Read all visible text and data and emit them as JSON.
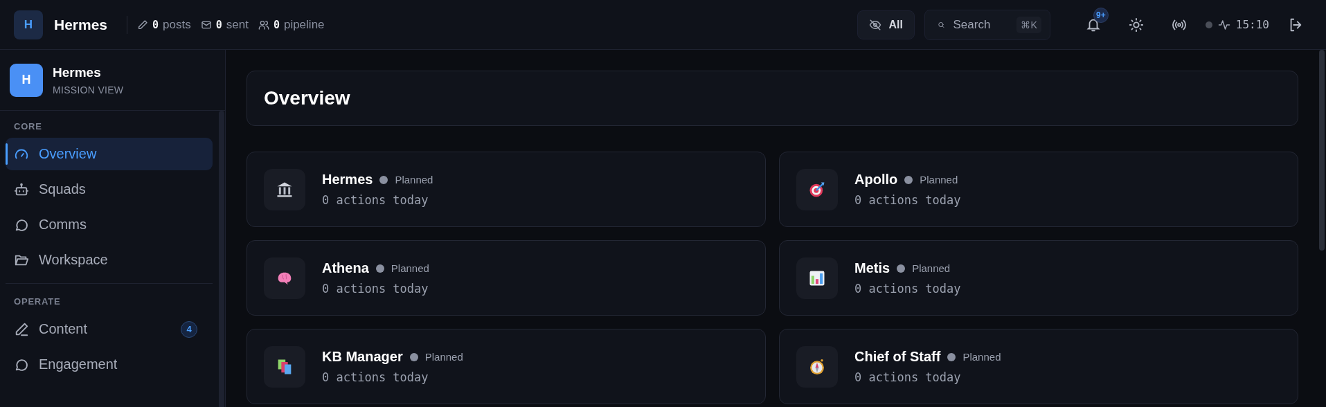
{
  "topbar": {
    "logo": "H",
    "title": "Hermes",
    "stats": [
      {
        "value": "0",
        "label": "posts"
      },
      {
        "value": "0",
        "label": "sent"
      },
      {
        "value": "0",
        "label": "pipeline"
      }
    ],
    "filter": {
      "label": "All"
    },
    "search": {
      "placeholder": "Search",
      "shortcut": "⌘K"
    },
    "notifications": {
      "badge": "9+"
    },
    "clock": "15:10"
  },
  "sidebar": {
    "logo": "H",
    "title": "Hermes",
    "subtitle": "MISSION VIEW",
    "sections": [
      {
        "label": "CORE",
        "items": [
          {
            "label": "Overview",
            "selected": true
          },
          {
            "label": "Squads",
            "selected": false
          },
          {
            "label": "Comms",
            "selected": false
          },
          {
            "label": "Workspace",
            "selected": false
          }
        ]
      },
      {
        "label": "OPERATE",
        "items": [
          {
            "label": "Content",
            "selected": false,
            "badge": "4"
          },
          {
            "label": "Engagement",
            "selected": false
          }
        ]
      }
    ]
  },
  "page": {
    "title": "Overview",
    "agents": [
      {
        "name": "Hermes",
        "status": "Planned",
        "activity": "0 actions today"
      },
      {
        "name": "Apollo",
        "status": "Planned",
        "activity": "0 actions today"
      },
      {
        "name": "Athena",
        "status": "Planned",
        "activity": "0 actions today"
      },
      {
        "name": "Metis",
        "status": "Planned",
        "activity": "0 actions today"
      },
      {
        "name": "KB Manager",
        "status": "Planned",
        "activity": "0 actions today"
      },
      {
        "name": "Chief of Staff",
        "status": "Planned",
        "activity": "0 actions today"
      }
    ]
  }
}
